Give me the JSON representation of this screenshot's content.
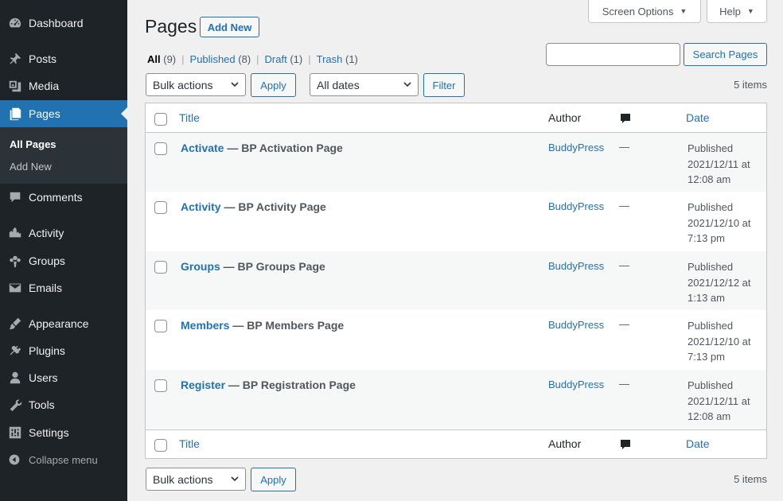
{
  "sidebar": {
    "items": [
      {
        "key": "dashboard",
        "label": "Dashboard",
        "icon": "dashboard-icon"
      },
      {
        "key": "posts",
        "label": "Posts",
        "icon": "pin-icon"
      },
      {
        "key": "media",
        "label": "Media",
        "icon": "media-icon"
      },
      {
        "key": "pages",
        "label": "Pages",
        "icon": "pages-icon"
      },
      {
        "key": "comments",
        "label": "Comments",
        "icon": "comment-icon"
      },
      {
        "key": "activity",
        "label": "Activity",
        "icon": "activity-icon"
      },
      {
        "key": "groups",
        "label": "Groups",
        "icon": "groups-icon"
      },
      {
        "key": "emails",
        "label": "Emails",
        "icon": "email-icon"
      },
      {
        "key": "appearance",
        "label": "Appearance",
        "icon": "brush-icon"
      },
      {
        "key": "plugins",
        "label": "Plugins",
        "icon": "plug-icon"
      },
      {
        "key": "users",
        "label": "Users",
        "icon": "user-icon"
      },
      {
        "key": "tools",
        "label": "Tools",
        "icon": "wrench-icon"
      },
      {
        "key": "settings",
        "label": "Settings",
        "icon": "settings-icon"
      }
    ],
    "submenu": [
      "All Pages",
      "Add New"
    ],
    "collapse_label": "Collapse menu"
  },
  "header": {
    "screen_options": "Screen Options",
    "help": "Help",
    "title": "Pages",
    "add_new": "Add New"
  },
  "filters": {
    "all_label": "All",
    "all_count": "(9)",
    "published_label": "Published",
    "published_count": "(8)",
    "draft_label": "Draft",
    "draft_count": "(1)",
    "trash_label": "Trash",
    "trash_count": "(1)",
    "separator": "|"
  },
  "search": {
    "button": "Search Pages",
    "value": ""
  },
  "toolbar": {
    "bulk_actions": "Bulk actions",
    "apply": "Apply",
    "all_dates": "All dates",
    "filter": "Filter",
    "items_count": "5 items"
  },
  "table": {
    "columns": {
      "title": "Title",
      "author": "Author",
      "date": "Date"
    },
    "rows": [
      {
        "title": "Activate",
        "suffix": "— BP Activation Page",
        "author": "BuddyPress",
        "comments": "—",
        "status": "Published",
        "date": "2021/12/11 at",
        "time": "12:08 am"
      },
      {
        "title": "Activity",
        "suffix": "— BP Activity Page",
        "author": "BuddyPress",
        "comments": "—",
        "status": "Published",
        "date": "2021/12/10 at",
        "time": "7:13 pm"
      },
      {
        "title": "Groups",
        "suffix": "— BP Groups Page",
        "author": "BuddyPress",
        "comments": "—",
        "status": "Published",
        "date": "2021/12/12 at",
        "time": "1:13 am"
      },
      {
        "title": "Members",
        "suffix": "— BP Members Page",
        "author": "BuddyPress",
        "comments": "—",
        "status": "Published",
        "date": "2021/12/10 at",
        "time": "7:13 pm"
      },
      {
        "title": "Register",
        "suffix": "— BP Registration Page",
        "author": "BuddyPress",
        "comments": "—",
        "status": "Published",
        "date": "2021/12/11 at",
        "time": "12:08 am"
      }
    ]
  },
  "colors": {
    "sidebar_bg": "#1d2327",
    "accent": "#2271b1",
    "page_bg": "#f0f0f1"
  }
}
